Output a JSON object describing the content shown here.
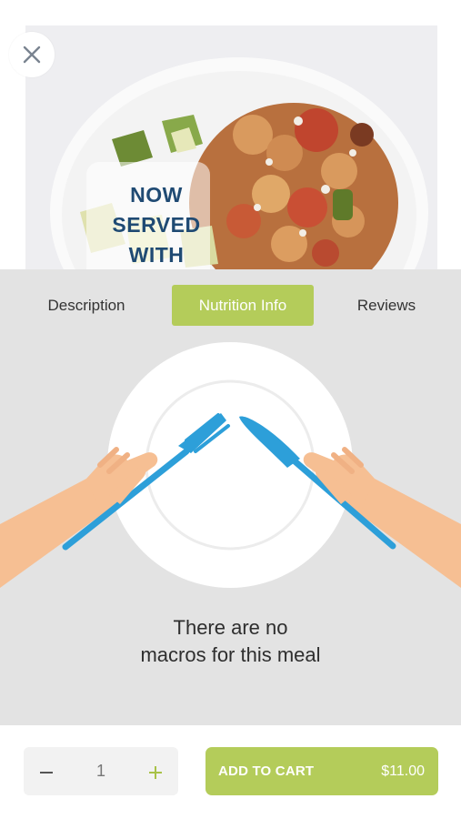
{
  "header": {
    "close_icon": "close-icon",
    "badge_lines": [
      "NOW",
      "SERVED",
      "WITH"
    ]
  },
  "tabs": [
    {
      "label": "Description",
      "active": false
    },
    {
      "label": "Nutrition Info",
      "active": true
    },
    {
      "label": "Reviews",
      "active": false
    }
  ],
  "nutrition": {
    "empty_line1": "There are no",
    "empty_line2": "macros for this meal"
  },
  "footer": {
    "minus_icon": "minus-icon",
    "plus_icon": "plus-icon",
    "quantity": "1",
    "add_label": "ADD TO CART",
    "price": "$11.00"
  },
  "colors": {
    "accent": "#b4cc5a",
    "panel_bg": "#e3e3e3",
    "badge_text": "#1f4a73",
    "utensil_blue": "#2d9fd9",
    "skin": "#f6bf93"
  }
}
